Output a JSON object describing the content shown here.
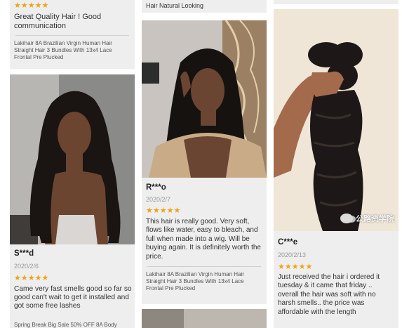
{
  "col1": {
    "top_card": {
      "stars": "★★★★★",
      "review": "Great Quality Hair ! Good communication",
      "product": "Lakihair 8A Brazilian Virgin Human Hair Straight Hair 3 Bundles With 13x4 Lace Frontal Pre Plucked"
    },
    "card2": {
      "name": "S***d",
      "date": "2020/2/6",
      "stars": "★★★★★",
      "review": "Came very fast smells good so far so good can't wait to get it installed and got some free lashes",
      "product": "Spring Break Big Sale 50% OFF 8A Body"
    }
  },
  "col2": {
    "top_card": {
      "review_tail": "Hair Natural Looking"
    },
    "card2": {
      "name": "R***o",
      "date": "2020/2/7",
      "stars": "★★★★★",
      "review": "This hair is really good. Very soft, flows like water, easy to bleach, and full when made into a wig. Will be buying again. It is definitely worth the price.",
      "product": "Lakihair 8A Brazilian Virgin Human Hair Straight Hair 3 Bundles With 13x4 Lace Frontal Pre Plucked"
    }
  },
  "col3": {
    "card1": {
      "name": "C***e",
      "date": "2020/2/13",
      "stars": "★★★★★",
      "review": "Just received the hair i ordered it tuesday & it came that friday .. overall the hair was soft with no harsh smells.. the price was affordable with the length"
    }
  },
  "watermark": {
    "text": "公路资学院"
  },
  "colors": {
    "star": "#f0a312",
    "card_bg": "#eeeeee"
  }
}
